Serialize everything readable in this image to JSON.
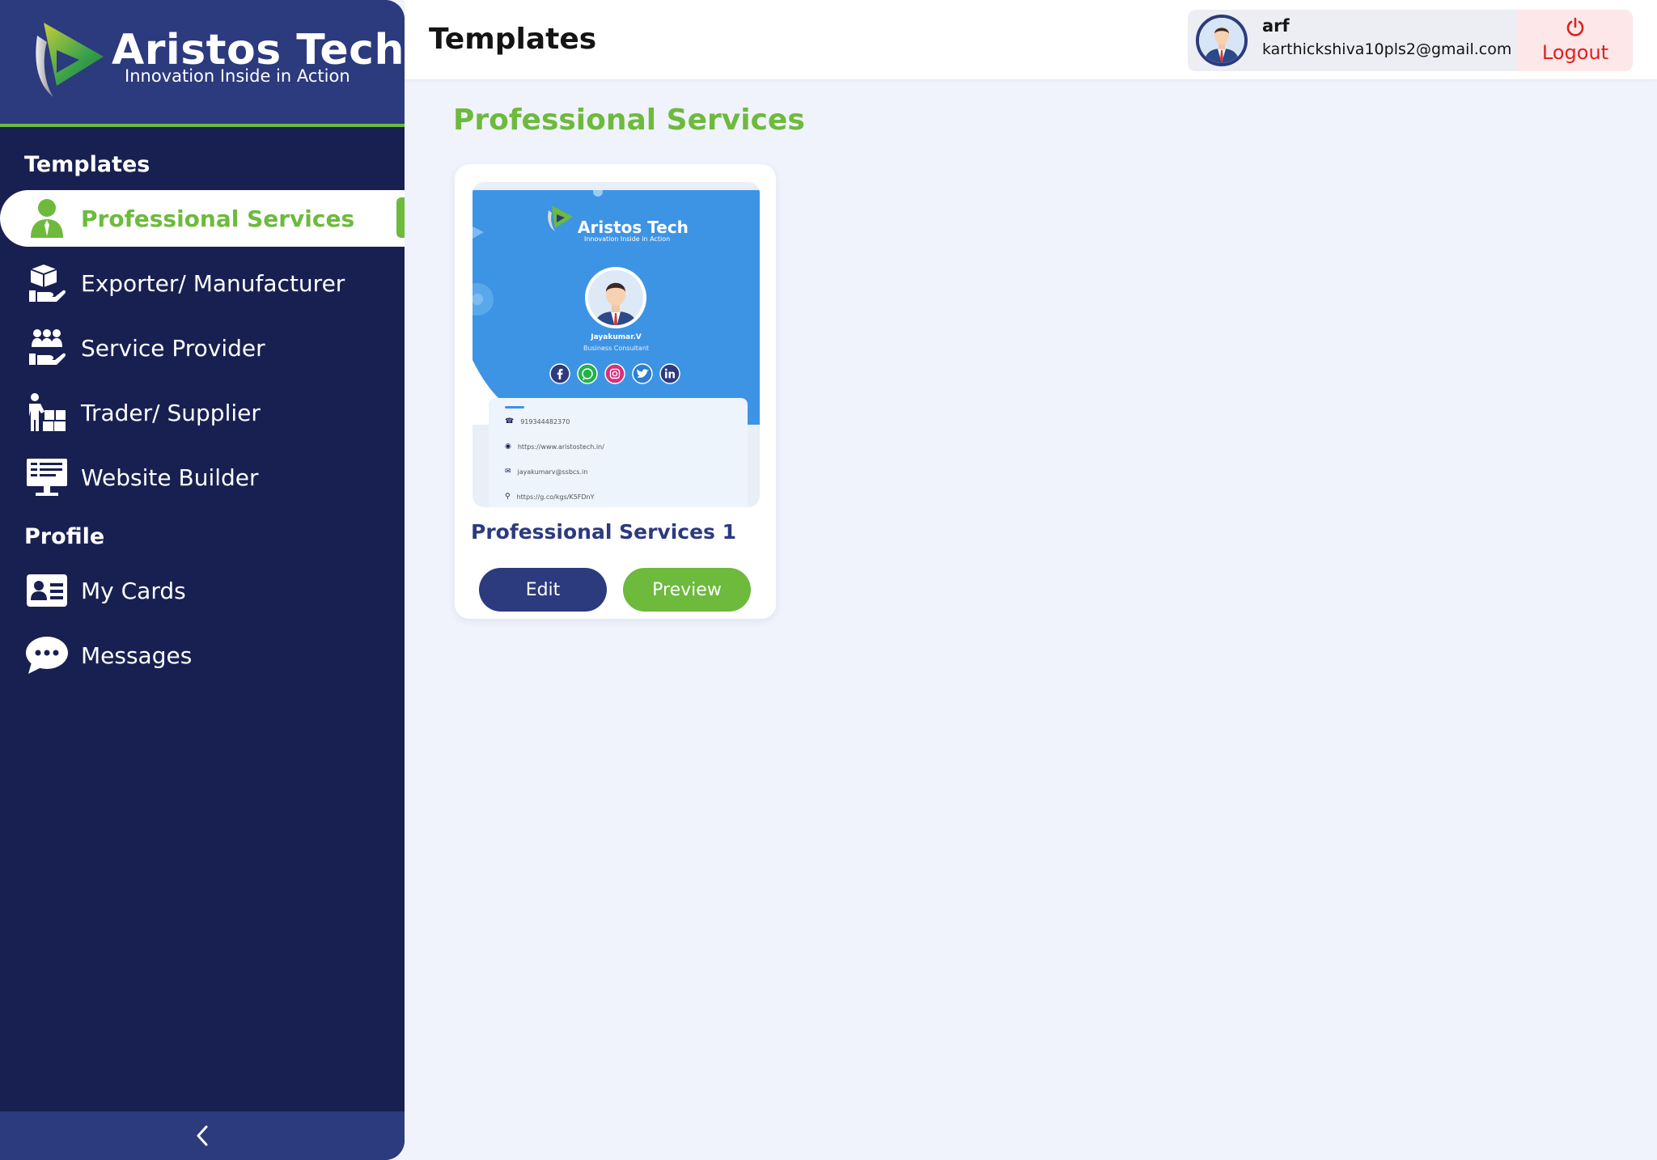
{
  "brand": {
    "title": "Aristos Tech",
    "tagline": "Innovation Inside in Action"
  },
  "sidebar": {
    "templates_heading": "Templates",
    "profile_heading": "Profile",
    "items": [
      {
        "label": "Professional Services",
        "icon": "person-icon",
        "active": true
      },
      {
        "label": "Exporter/ Manufacturer",
        "icon": "boxes-hand-icon"
      },
      {
        "label": "Service Provider",
        "icon": "group-hand-icon"
      },
      {
        "label": "Trader/ Supplier",
        "icon": "trader-boxes-icon"
      },
      {
        "label": "Website Builder",
        "icon": "monitor-icon"
      }
    ],
    "profile_items": [
      {
        "label": "My Cards",
        "icon": "id-card-icon"
      },
      {
        "label": "Messages",
        "icon": "chat-bubble-icon"
      }
    ],
    "collapse_icon": "chevron-left-icon"
  },
  "header": {
    "title": "Templates",
    "user": {
      "name": "arf",
      "email": "karthickshiva10pls2@gmail.com"
    },
    "logout_label": "Logout"
  },
  "main": {
    "section_title": "Professional Services",
    "cards": [
      {
        "name": "Professional Services 1",
        "edit_label": "Edit",
        "preview_label": "Preview",
        "thumbnail": {
          "brand": "Aristos Tech",
          "tagline": "Innovation Inside in Action",
          "person_name": "Jayakumar.V",
          "person_role": "Business Consultant",
          "phone": "919344482370",
          "website": "https://www.aristostech.in/",
          "email": "jayakumarv@ssbcs.in",
          "location": "https://g.co/kgs/K5FDnY"
        }
      }
    ]
  },
  "colors": {
    "sidebar_bg": "#182052",
    "sidebar_head_bg": "#2c3a7e",
    "accent_green": "#6dba3d",
    "primary_navy": "#2c3a7e",
    "logout_red": "#e02020",
    "page_bg": "#f0f3fc",
    "card_blue": "#3d94e5"
  }
}
